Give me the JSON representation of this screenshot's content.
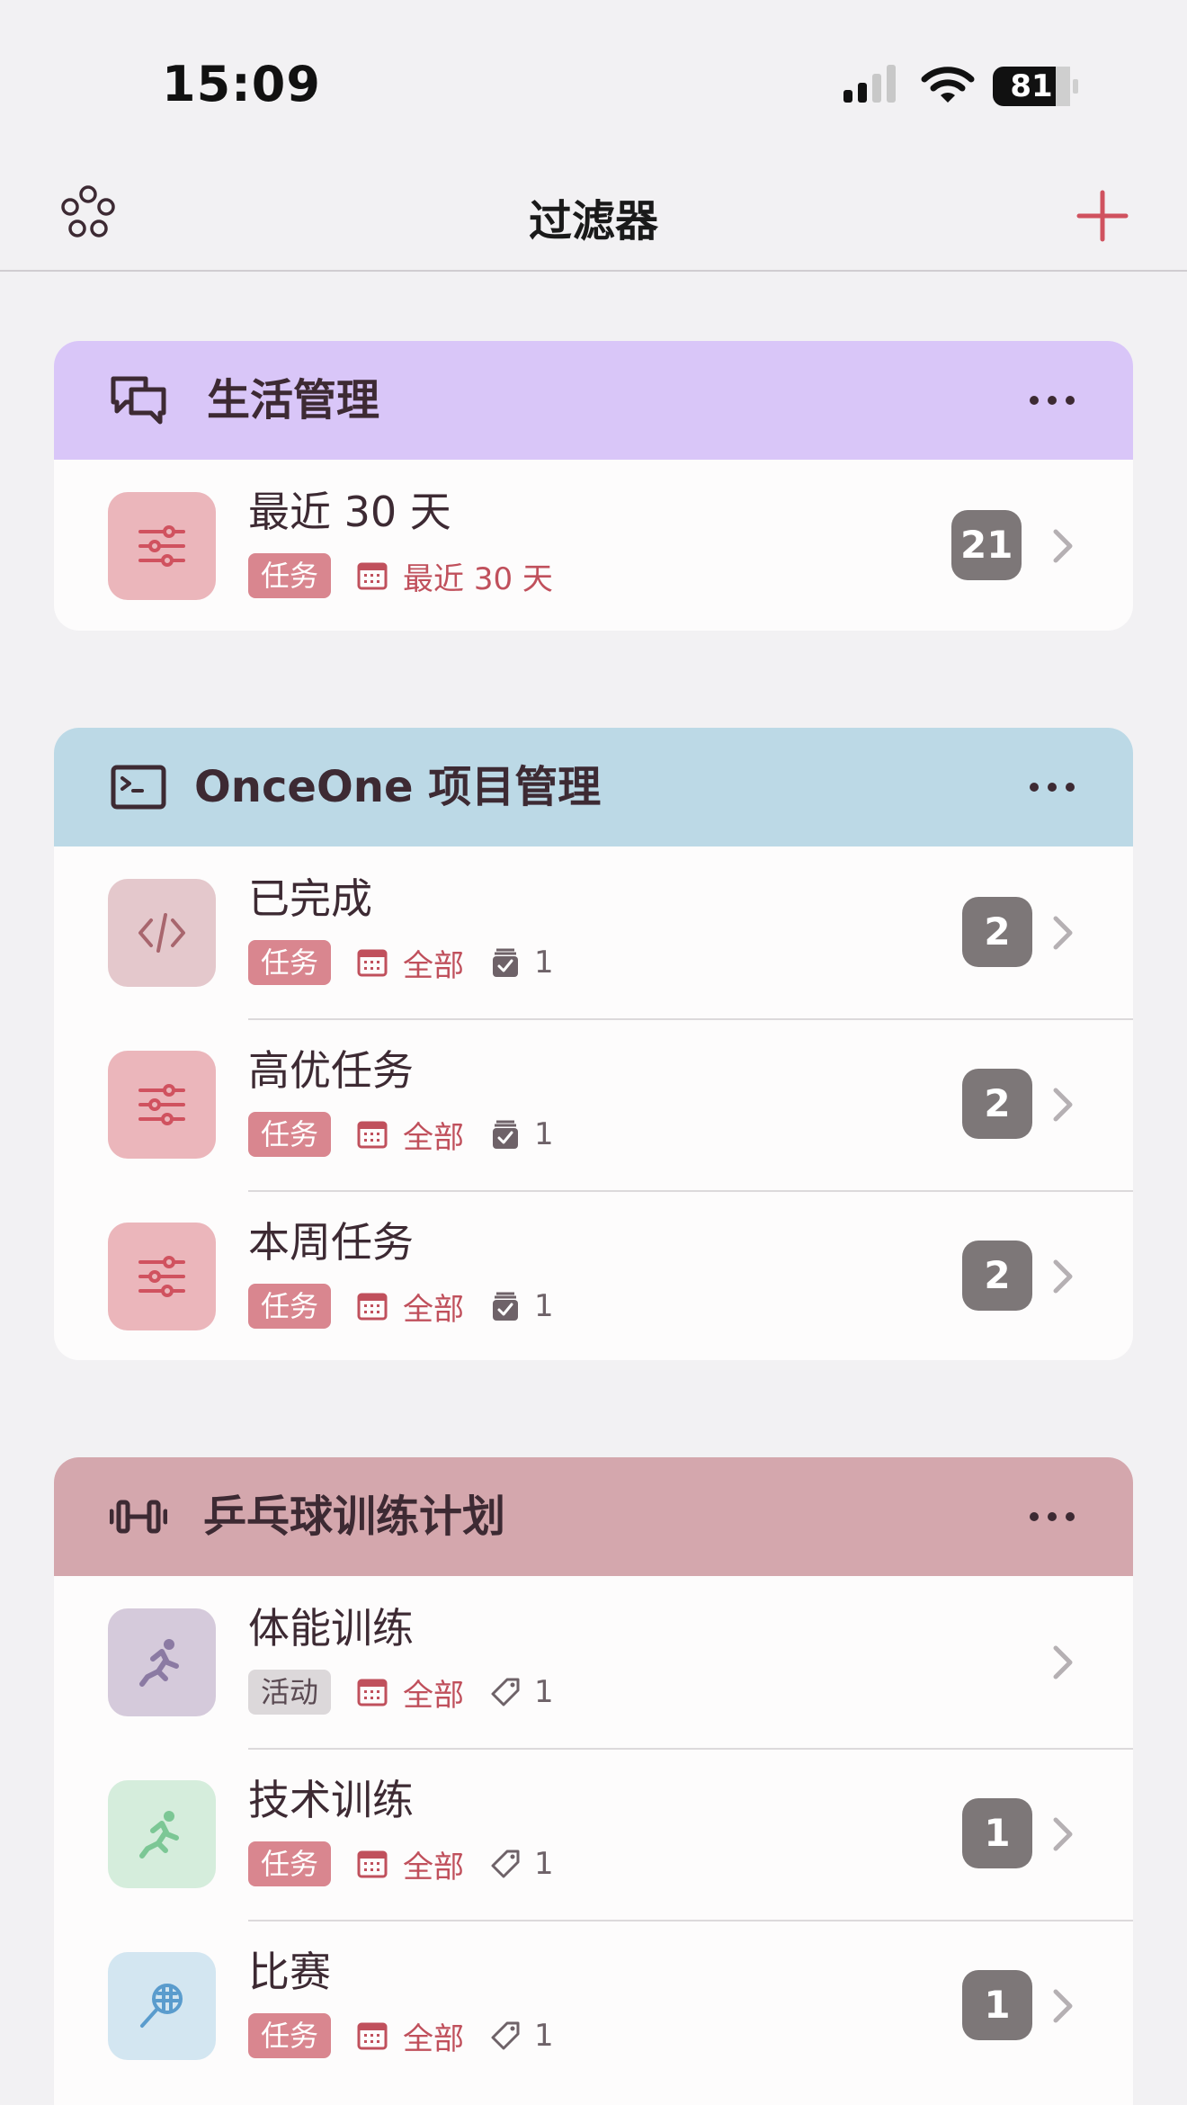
{
  "status_bar": {
    "time": "15:09",
    "battery": "81"
  },
  "nav": {
    "title": "过滤器"
  },
  "groups": [
    {
      "title": "生活管理",
      "header_color": "#d9c6f8",
      "items": [
        {
          "title": "最近 30 天",
          "tag": "任务",
          "range": "最近 30 天",
          "count": "21",
          "tile_color": "#ebb6bb",
          "icon": "sliders-icon"
        }
      ]
    },
    {
      "title": "OnceOne 项目管理",
      "header_color": "#bcd9e6",
      "items": [
        {
          "title": "已完成",
          "tag": "任务",
          "range": "全部",
          "sub_count": "1",
          "count": "2",
          "tile_color": "#e4c8cc",
          "icon": "code-icon"
        },
        {
          "title": "高优任务",
          "tag": "任务",
          "range": "全部",
          "sub_count": "1",
          "count": "2",
          "tile_color": "#ebb6bb",
          "icon": "sliders-icon"
        },
        {
          "title": "本周任务",
          "tag": "任务",
          "range": "全部",
          "sub_count": "1",
          "count": "2",
          "tile_color": "#ebb6bb",
          "icon": "sliders-icon"
        }
      ]
    },
    {
      "title": "乒乓球训练计划",
      "header_color": "#d4a7ad",
      "items": [
        {
          "title": "体能训练",
          "tag": "活动",
          "range": "全部",
          "sub_count": "1",
          "tile_color": "#d5cadb",
          "icon": "runner-icon"
        },
        {
          "title": "技术训练",
          "tag": "任务",
          "range": "全部",
          "sub_count": "1",
          "count": "1",
          "tile_color": "#d5eddc",
          "icon": "runner-icon"
        },
        {
          "title": "比赛",
          "tag": "任务",
          "range": "全部",
          "sub_count": "1",
          "count": "1",
          "tile_color": "#d3e6f1",
          "icon": "racket-icon"
        }
      ]
    }
  ]
}
